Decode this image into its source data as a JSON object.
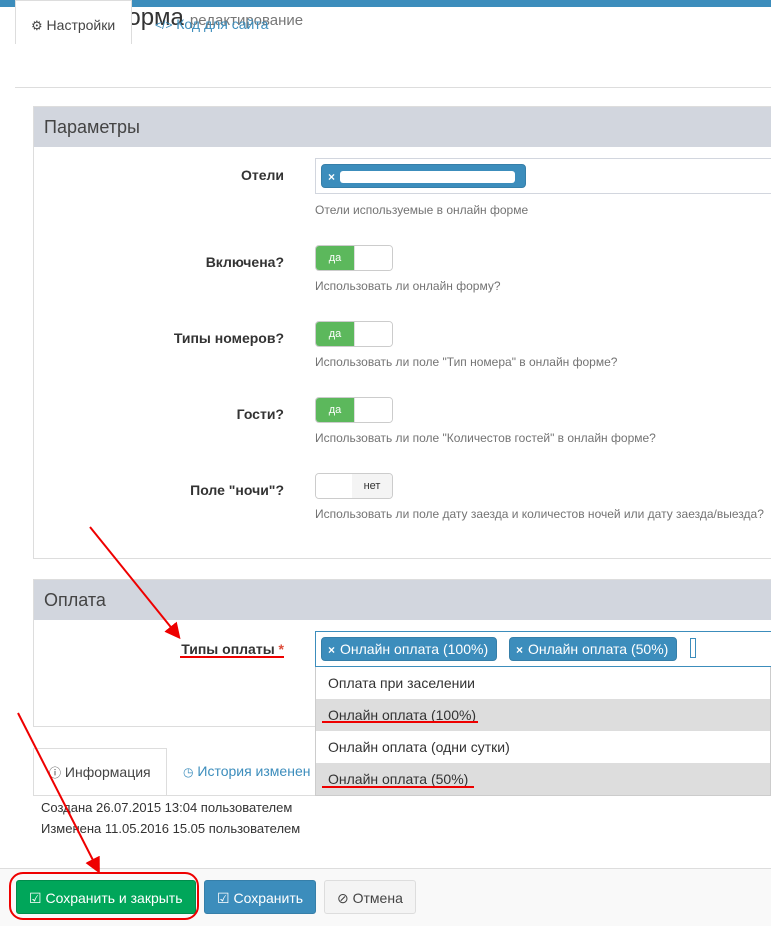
{
  "header": {
    "title": "Онлайн форма",
    "subtitle": "редактирование"
  },
  "tabs": [
    {
      "label": "Настройки",
      "icon": "gear-icon"
    },
    {
      "label": "Код для сайта",
      "icon": "code-icon"
    }
  ],
  "params_panel": {
    "title": "Параметры",
    "hotels": {
      "label": "Отели",
      "tag": "",
      "help": "Отели используемые в онлайн форме"
    },
    "enabled": {
      "label": "Включена?",
      "state": "да",
      "help": "Использовать ли онлайн форму?"
    },
    "room_types": {
      "label": "Типы номеров?",
      "state": "да",
      "help": "Использовать ли поле \"Тип номера\" в онлайн форме?"
    },
    "guests": {
      "label": "Гости?",
      "state": "да",
      "help": "Использовать ли поле \"Количестов гостей\" в онлайн форме?"
    },
    "nights": {
      "label": "Поле \"ночи\"?",
      "state": "нет",
      "help": "Использовать ли поле дату заезда и количестов ночей или дату заезда/выезда?"
    }
  },
  "payment_panel": {
    "title": "Оплата",
    "types_label": "Типы оплаты",
    "required_mark": "*",
    "selected_tags": [
      "Онлайн оплата (100%)",
      "Онлайн оплата (50%)"
    ],
    "options": [
      {
        "label": "Оплата при заселении",
        "selected": false
      },
      {
        "label": "Онлайн оплата (100%)",
        "selected": true
      },
      {
        "label": "Онлайн оплата (одни сутки)",
        "selected": false
      },
      {
        "label": "Онлайн оплата (50%)",
        "selected": true
      }
    ]
  },
  "bottom_tabs": [
    {
      "label": "Информация",
      "icon": "info-icon"
    },
    {
      "label": "История изменен",
      "icon": "clock-icon"
    }
  ],
  "info": {
    "created": "Создана 26.07.2015 13:04 пользователем",
    "modified": "Изменена 11.05.2016 15.05 пользователем"
  },
  "buttons": {
    "save_close": "Сохранить и закрыть",
    "save": "Сохранить",
    "cancel": "Отмена"
  },
  "colors": {
    "primary": "#3c8dbc",
    "success": "#00a65a",
    "toggle_on": "#5cb85c",
    "annotation": "#e00000"
  }
}
